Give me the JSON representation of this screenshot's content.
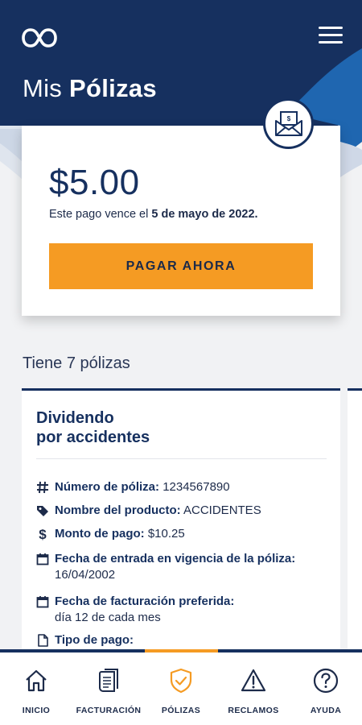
{
  "header": {
    "title_light": "Mis ",
    "title_bold": "Pólizas",
    "logo_icon": "infinity-logo-icon",
    "menu_icon": "hamburger-menu-icon"
  },
  "payment": {
    "amount": "$5.00",
    "due_prefix": "Este pago vence el ",
    "due_date": "5 de mayo de 2022.",
    "button_label": "PAGAR AHORA",
    "badge_icon": "mail-bill-icon"
  },
  "policies": {
    "count_label": "Tiene 7 pólizas",
    "card": {
      "title_line1": "Dividendo",
      "title_line2": "por accidentes",
      "rows": [
        {
          "icon": "hash-icon",
          "label": "Número de póliza:",
          "value": "1234567890"
        },
        {
          "icon": "tag-icon",
          "label": "Nombre del producto:",
          "value": "ACCIDENTES"
        },
        {
          "icon": "dollar-icon",
          "label": "Monto de pago:",
          "value": "$10.25"
        },
        {
          "icon": "calendar-icon",
          "label": "Fecha de entrada en vigencia de la póliza:",
          "value": "16/04/2002"
        },
        {
          "icon": "calendar-icon",
          "label": "Fecha de facturación preferida:",
          "value": "día 12 de cada mes"
        },
        {
          "icon": "document-icon",
          "label": "Tipo de pago:",
          "value": ""
        }
      ]
    }
  },
  "nav": {
    "items": [
      {
        "label": "INICIO",
        "icon": "home-icon"
      },
      {
        "label": "FACTURACIÓN",
        "icon": "invoice-icon"
      },
      {
        "label": "PÓLIZAS",
        "icon": "shield-check-icon",
        "active": true
      },
      {
        "label": "RECLAMOS",
        "icon": "warning-icon"
      },
      {
        "label": "AYUDA",
        "icon": "help-icon"
      }
    ]
  },
  "colors": {
    "navy": "#16305f",
    "accent_blue": "#1f66b0",
    "orange": "#f59b23",
    "background": "#f1f2f4"
  }
}
